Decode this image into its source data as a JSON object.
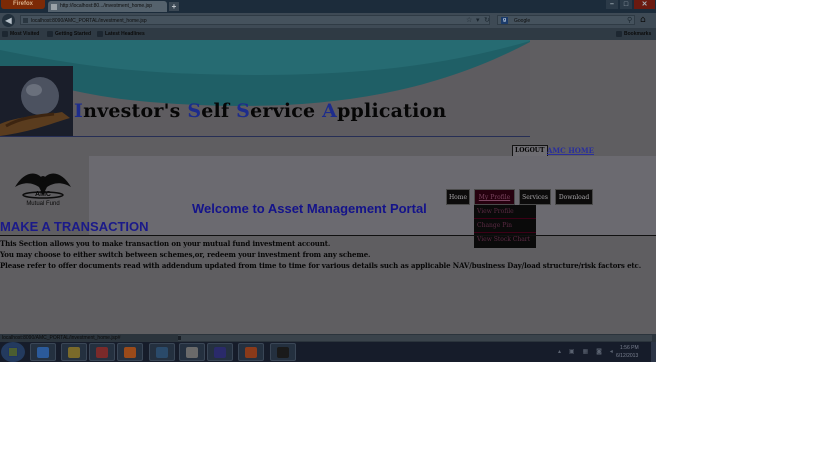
{
  "browser": {
    "app_button": "Firefox",
    "tab_title": "http://localhost:80.../investment_home.jsp",
    "url": "localhost:8090/AMC_PORTAL/investment_home.jsp",
    "search_placeholder": "Google",
    "bookmarks": [
      "Most Visited",
      "Getting Started",
      "Latest Headlines"
    ],
    "bookmarks_menu": "Bookmarks",
    "status_url": "localhost:8090/AMC_PORTAL/investment_home.jsp#"
  },
  "header": {
    "title_parts": [
      {
        "initial": "I",
        "rest": "nvestor's "
      },
      {
        "initial": "S",
        "rest": "elf "
      },
      {
        "initial": "S",
        "rest": "ervice "
      },
      {
        "initial": "A",
        "rest": "pplication"
      }
    ],
    "initial_color": "#1d2c8c"
  },
  "top_links": {
    "logout": "LOGOUT",
    "amc_home": "AMC HOME"
  },
  "logo": {
    "name": "AMC",
    "subtitle": "Mutual Fund"
  },
  "welcome": "Welcome to Asset Management Portal",
  "menu": {
    "home": "Home",
    "my_profile": "My Profile",
    "services": "Services",
    "download": "Download",
    "profile_dropdown": [
      "View Profile",
      "Change Pin",
      "View Stock Chart"
    ]
  },
  "transaction": {
    "title": "MAKE A TRANSACTION",
    "lines": [
      "This Section allows you to make transaction on your mutual fund investment account.",
      "You may choose to either switch between schemes,or, redeem your investment from any scheme.",
      "Please refer to offer documents read with addendum updated from time to time for various details such as applicable NAV/business Day/load structure/risk factors etc."
    ]
  },
  "taskbar": {
    "time": "1:56 PM",
    "date": "6/12/2013",
    "items": [
      "ie",
      "explorer",
      "media",
      "firefox",
      "app",
      "app2",
      "eclipse",
      "chrome",
      "d"
    ],
    "icon_colors": [
      "#2b5a9a",
      "#7a6a2a",
      "#7a2a2a",
      "#9a4a1a",
      "#2a4a6a",
      "#6a6a6a",
      "#2a2a6a",
      "#8a3a1a",
      "#1a1a1a"
    ]
  },
  "colors": {
    "accent_title": "#1b1a89",
    "link": "#2a2f9c",
    "wave": "#1f5f66"
  }
}
